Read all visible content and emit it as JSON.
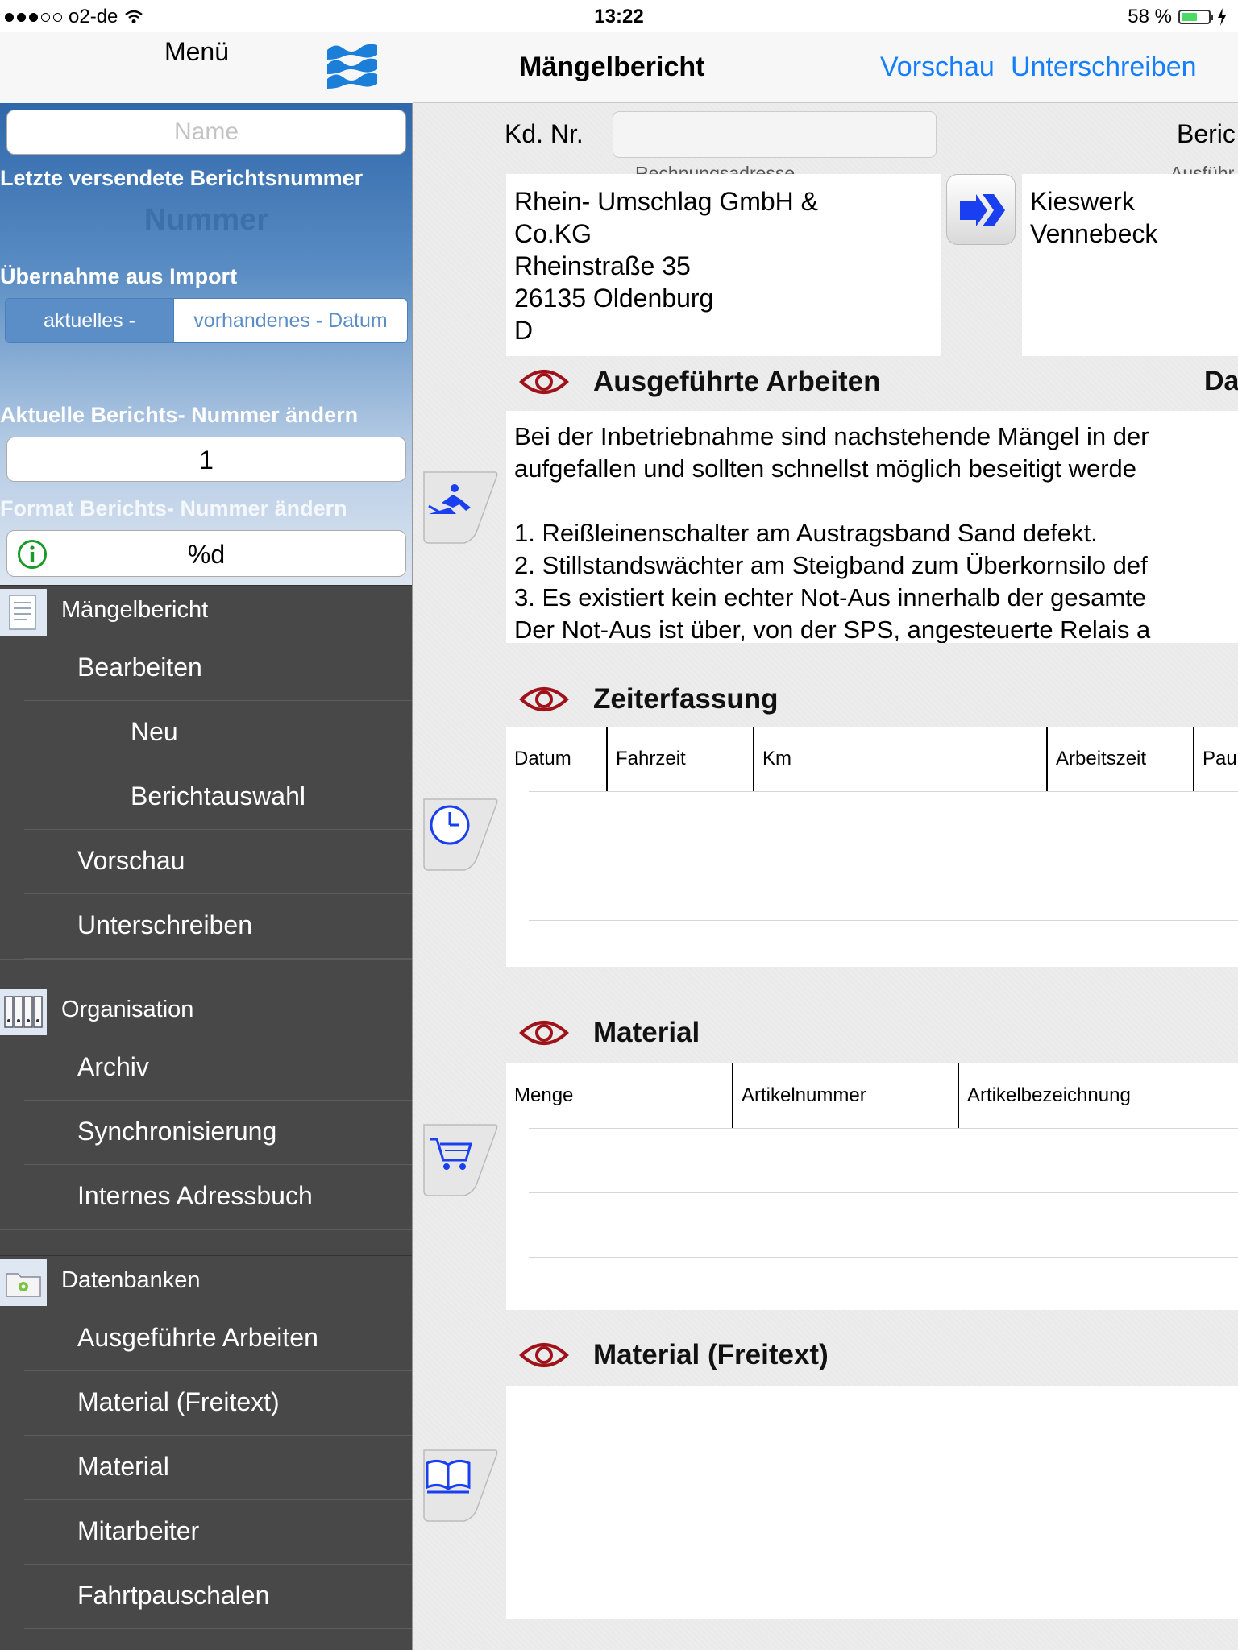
{
  "status_bar": {
    "carrier": "o2-de",
    "time": "13:22",
    "battery": "58 %",
    "battery_level": 0.58
  },
  "left_nav": {
    "title": "Menü",
    "logo_icon": "waves-logo-icon"
  },
  "right_nav": {
    "title": "Mängelbericht",
    "preview_label": "Vorschau",
    "sign_label": "Unterschreiben"
  },
  "settings": {
    "name_placeholder": "Name",
    "last_report_label": "Letzte versendete Berichtsnummer",
    "last_report_value": "Nummer",
    "import_label": "Übernahme aus Import",
    "import_options": [
      "aktuelles -",
      "vorhandenes - Datum"
    ],
    "change_number_label": "Aktuelle Berichts- Nummer ändern",
    "current_number": "1",
    "format_label": "Format Berichts- Nummer ändern",
    "format_value": "%d"
  },
  "menu": {
    "sections": [
      {
        "title": "Mängelbericht",
        "icon": "document-icon"
      },
      {
        "title": "Organisation",
        "icon": "binders-icon"
      },
      {
        "title": "Datenbanken",
        "icon": "database-folder-icon"
      }
    ],
    "maengelbericht_items": [
      "Bearbeiten",
      "Neu",
      "Berichtauswahl",
      "Vorschau",
      "Unterschreiben"
    ],
    "organisation_items": [
      "Archiv",
      "Synchronisierung",
      "Internes Adressbuch"
    ],
    "datenbanken_items": [
      "Ausgeführte Arbeiten",
      "Material (Freitext)",
      "Material",
      "Mitarbeiter",
      "Fahrtpauschalen"
    ]
  },
  "form": {
    "customer_no_label": "Kd. Nr.",
    "report_label": "Beric",
    "billing_address_label": "Rechnungsadresse",
    "billing_address": [
      "Rhein- Umschlag GmbH &",
      "Co.KG",
      "Rheinstraße 35",
      "26135 Oldenburg",
      "D"
    ],
    "execution_label": "Ausführ",
    "execution_address": [
      "Kieswerk",
      "Vennebeck"
    ],
    "date_label": "Da"
  },
  "sections": {
    "work": {
      "title": "Ausgeführte Arbeiten",
      "lines": [
        "Bei der Inbetriebnahme sind nachstehende Mängel in der",
        "aufgefallen und sollten schnellst möglich beseitigt werde",
        "",
        "1. Reißleinenschalter am Austragsband Sand defekt.",
        "2. Stillstandswächter am Steigband zum Überkornsilo def",
        "3. Es existiert kein echter Not-Aus innerhalb der gesamte",
        "Der Not-Aus ist über, von der SPS, angesteuerte Relais a"
      ]
    },
    "time": {
      "title": "Zeiterfassung",
      "columns": [
        "Datum",
        "Fahrzeit",
        "Km",
        "Arbeitszeit",
        "Pau"
      ]
    },
    "material": {
      "title": "Material",
      "columns": [
        "Menge",
        "Artikelnummer",
        "Artikelbezeichnung"
      ]
    },
    "material_free": {
      "title": "Material (Freitext)"
    }
  },
  "colors": {
    "accent": "#157efb",
    "eye_red": "#a0121a",
    "sidebar_dark": "#484848",
    "sidebar_blue": "#2f67aa"
  }
}
